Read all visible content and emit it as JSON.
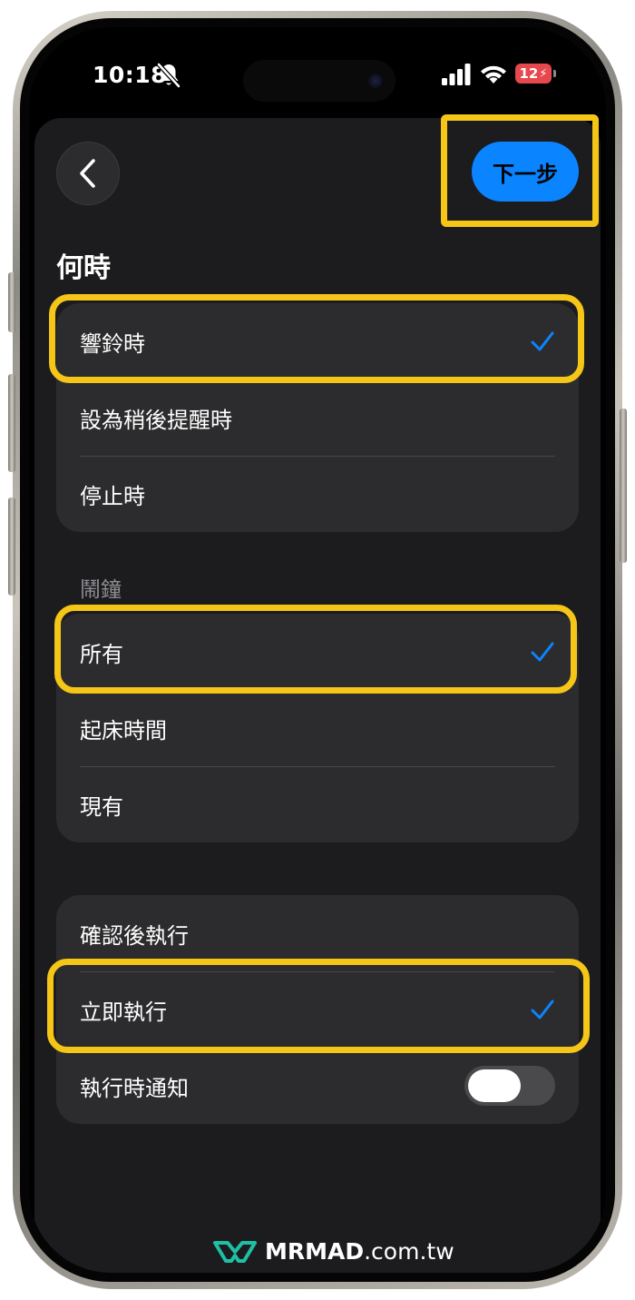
{
  "status_bar": {
    "time": "10:18",
    "battery_level": "12",
    "battery_color": "#e5484d"
  },
  "header": {
    "back_icon": "chevron-left-icon",
    "next_label": "下一步",
    "next_color": "#0a84ff"
  },
  "when_section": {
    "title": "何時",
    "options": [
      {
        "label": "響鈴時",
        "selected": true
      },
      {
        "label": "設為稍後提醒時",
        "selected": false
      },
      {
        "label": "停止時",
        "selected": false
      }
    ]
  },
  "alarm_section": {
    "label": "鬧鐘",
    "options": [
      {
        "label": "所有",
        "selected": true
      },
      {
        "label": "起床時間",
        "selected": false
      },
      {
        "label": "現有",
        "selected": false
      }
    ]
  },
  "run_section": {
    "options": [
      {
        "label": "確認後執行",
        "selected": false
      },
      {
        "label": "立即執行",
        "selected": true
      }
    ],
    "notify_label": "執行時通知",
    "notify_enabled": false
  },
  "annotation_color": "#f5c518",
  "watermark": {
    "brand_strong": "MRMAD",
    "brand_light": ".com.tw"
  }
}
